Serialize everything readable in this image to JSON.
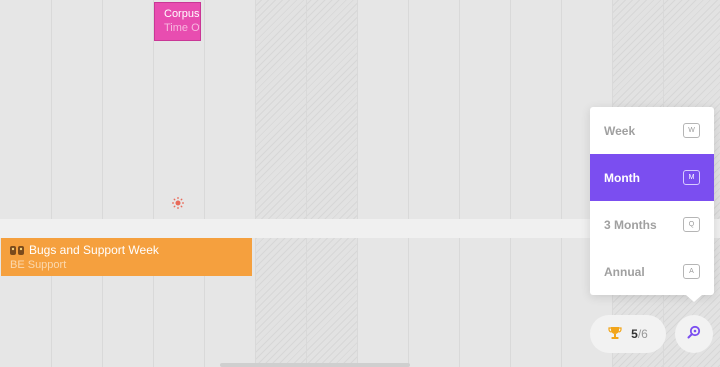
{
  "events": {
    "corpus": {
      "title": "Corpus",
      "subtitle": "Time Off",
      "color": "#e84db0"
    },
    "bugs": {
      "title": "Bugs and Support Week",
      "subtitle": "BE Support",
      "color": "#f5a03e"
    }
  },
  "zoom_menu": {
    "items": [
      {
        "label": "Week",
        "shortcut": "W",
        "selected": false
      },
      {
        "label": "Month",
        "shortcut": "M",
        "selected": true
      },
      {
        "label": "3 Months",
        "shortcut": "Q",
        "selected": false
      },
      {
        "label": "Annual",
        "shortcut": "A",
        "selected": false
      }
    ],
    "accent": "#7b4ef0"
  },
  "score": {
    "current": "5",
    "total": "/6",
    "icon": "trophy-icon"
  },
  "zoom_button": {
    "icon": "zoom-icon"
  }
}
